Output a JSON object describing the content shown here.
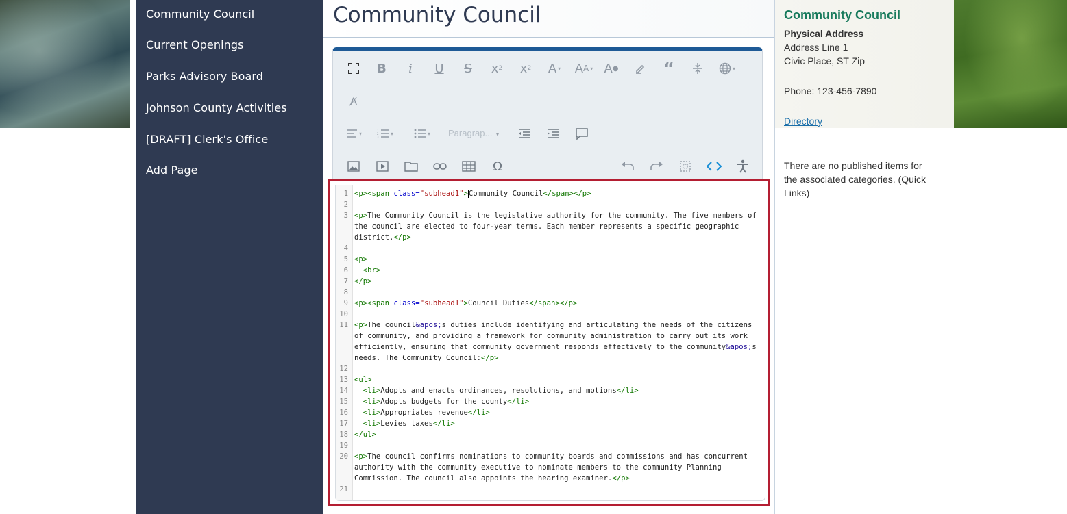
{
  "sidebar": {
    "items": [
      {
        "label": "Community Council"
      },
      {
        "label": "Current Openings"
      },
      {
        "label": "Parks Advisory Board"
      },
      {
        "label": "Johnson County Activities"
      },
      {
        "label": "[DRAFT] Clerk's Office"
      },
      {
        "label": "Add Page"
      }
    ]
  },
  "main": {
    "title": "Community Council",
    "toolbar": {
      "paragraph_label": "Paragrap..."
    }
  },
  "code": {
    "lines": [
      {
        "n": "1",
        "html": "<span class=\"tag\">&lt;p&gt;&lt;span</span> <span class=\"attr\">class=</span><span class=\"str\">\"subhead1\"</span><span class=\"tag\">&gt;</span><span class=\"cursor\"></span>Community Council<span class=\"tag\">&lt;/span&gt;&lt;/p&gt;</span>"
      },
      {
        "n": "2",
        "html": ""
      },
      {
        "n": "3",
        "html": "<span class=\"tag\">&lt;p&gt;</span>The Community Council is the legislative authority for the community. The five members of\nthe council are elected to four-year terms. Each member represents a specific geographic\ndistrict.<span class=\"tag\">&lt;/p&gt;</span>"
      },
      {
        "n": "4",
        "html": ""
      },
      {
        "n": "5",
        "html": "<span class=\"tag\">&lt;p&gt;</span>"
      },
      {
        "n": "6",
        "html": "  <span class=\"tag\">&lt;br&gt;</span>"
      },
      {
        "n": "7",
        "html": "<span class=\"tag\">&lt;/p&gt;</span>"
      },
      {
        "n": "8",
        "html": ""
      },
      {
        "n": "9",
        "html": "<span class=\"tag\">&lt;p&gt;&lt;span</span> <span class=\"attr\">class=</span><span class=\"str\">\"subhead1\"</span><span class=\"tag\">&gt;</span>Council Duties<span class=\"tag\">&lt;/span&gt;&lt;/p&gt;</span>"
      },
      {
        "n": "10",
        "html": ""
      },
      {
        "n": "11",
        "html": "<span class=\"tag\">&lt;p&gt;</span>The council<span class=\"ent\">&amp;apos;</span>s duties include identifying and articulating the needs of the citizens\nof community, and providing a framework for community administration to carry out its work\nefficiently, ensuring that community government responds effectively to the community<span class=\"ent\">&amp;apos;</span>s\nneeds. The Community Council:<span class=\"tag\">&lt;/p&gt;</span>"
      },
      {
        "n": "12",
        "html": ""
      },
      {
        "n": "13",
        "html": "<span class=\"tag\">&lt;ul&gt;</span>"
      },
      {
        "n": "14",
        "html": "  <span class=\"tag\">&lt;li&gt;</span>Adopts and enacts ordinances, resolutions, and motions<span class=\"tag\">&lt;/li&gt;</span>"
      },
      {
        "n": "15",
        "html": "  <span class=\"tag\">&lt;li&gt;</span>Adopts budgets for the county<span class=\"tag\">&lt;/li&gt;</span>"
      },
      {
        "n": "16",
        "html": "  <span class=\"tag\">&lt;li&gt;</span>Appropriates revenue<span class=\"tag\">&lt;/li&gt;</span>"
      },
      {
        "n": "17",
        "html": "  <span class=\"tag\">&lt;li&gt;</span>Levies taxes<span class=\"tag\">&lt;/li&gt;</span>"
      },
      {
        "n": "18",
        "html": "<span class=\"tag\">&lt;/ul&gt;</span>"
      },
      {
        "n": "19",
        "html": ""
      },
      {
        "n": "20",
        "html": "<span class=\"tag\">&lt;p&gt;</span>The council confirms nominations to community boards and commissions and has concurrent\nauthority with the community executive to nominate members to the community Planning\nCommission. The council also appoints the hearing examiner.<span class=\"tag\">&lt;/p&gt;</span>"
      },
      {
        "n": "21",
        "html": ""
      }
    ]
  },
  "contact": {
    "title": "Community Council",
    "address_heading": "Physical Address",
    "address_line1": "Address Line 1",
    "address_line2": "Civic Place, ST Zip",
    "phone": "Phone: 123-456-7890",
    "directory_link": "Directory",
    "no_items_line1": "There are no published items for",
    "no_items_line2": "the associated categories. (Quick",
    "no_items_line3": "Links)"
  }
}
